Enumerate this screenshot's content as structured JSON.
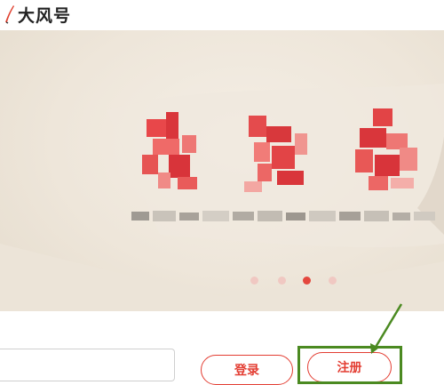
{
  "header": {
    "brand_name": "大风号",
    "logo_icon": "brush-stroke-logo-icon"
  },
  "banner": {
    "headline_censored": true,
    "subtitle_censored": true,
    "carousel_total": 4,
    "carousel_active_index": 2
  },
  "actions": {
    "login_label": "登录",
    "register_label": "注册"
  },
  "colors": {
    "accent": "#e33d32",
    "annotation_green": "#4b8a21"
  }
}
